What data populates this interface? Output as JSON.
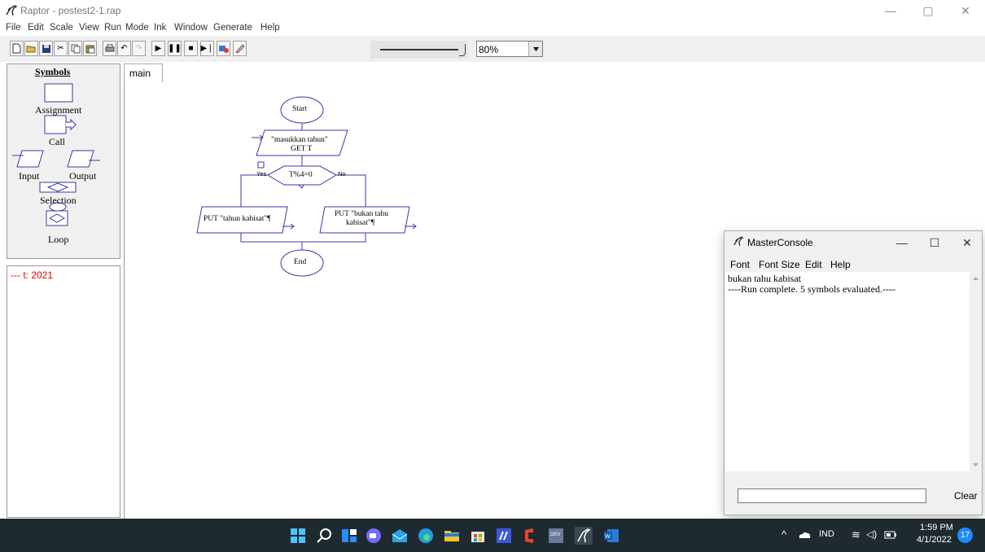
{
  "window": {
    "title": "Raptor - postest2-1.rap",
    "controls": [
      "minimize",
      "maximize",
      "close"
    ]
  },
  "menu": [
    "File",
    "Edit",
    "Scale",
    "View",
    "Run",
    "Mode",
    "Ink",
    "Window",
    "Generate",
    "Help"
  ],
  "toolbar": {
    "zoom_value": "80%",
    "zoom_level_fraction": 0.98
  },
  "palette": {
    "title": "Symbols",
    "assignment": "Assignment",
    "call": "Call",
    "input": "Input",
    "output": "Output",
    "selection": "Selection",
    "loop": "Loop"
  },
  "variables": [
    "--- t: 2021"
  ],
  "tabs": [
    {
      "label": "main"
    }
  ],
  "flowchart": {
    "start": "Start",
    "input_prompt": "\"masukkan tahun\"",
    "input_var": "GET T",
    "condition": "T%4=0",
    "yes": "Yes",
    "no": "No",
    "output_yes": "PUT \"tahun kabisat\"¶",
    "output_no_line1": "PUT \"bukan tahu",
    "output_no_line2": "kabisat\"¶",
    "end": "End"
  },
  "console": {
    "title": "MasterConsole",
    "menu": [
      "Font",
      "Font Size",
      "Edit",
      "Help"
    ],
    "output": [
      "bukan tahu kabisat",
      "----Run complete.  5 symbols evaluated.----"
    ],
    "clear_label": "Clear"
  },
  "taskbar": {
    "language": "IND",
    "time": "1:59 PM",
    "date": "4/1/2022",
    "notification_count": "17",
    "colors": {
      "background": "#1e2a30",
      "accent": "#1a8cff"
    }
  }
}
